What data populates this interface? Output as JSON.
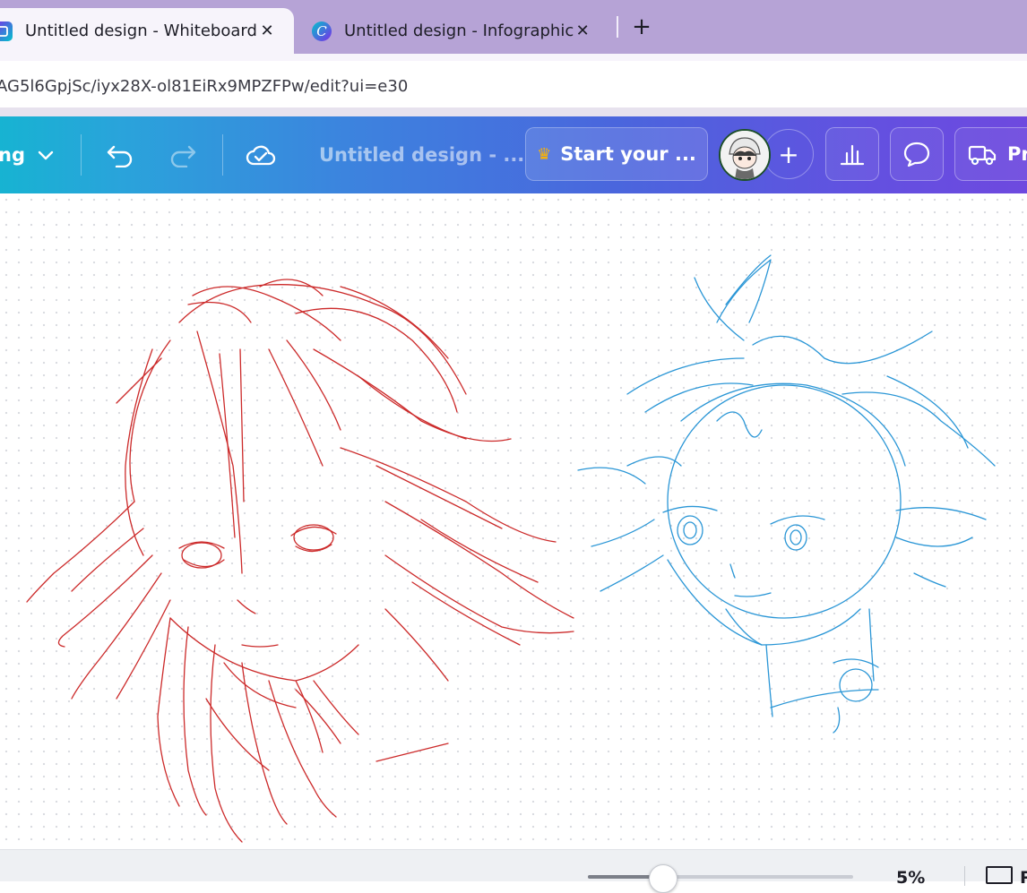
{
  "browser": {
    "tabs": [
      {
        "title": "Untitled design - Whiteboard",
        "active": true,
        "favicon": "canva-whiteboard-icon"
      },
      {
        "title": "Untitled design - Infographic",
        "active": false,
        "favicon": "canva-logo-icon"
      }
    ],
    "close_glyph": "✕",
    "new_tab_glyph": "+",
    "url": "AG5l6GpjSc/iyx28X-ol81EiRx9MPZFPw/edit?ui=e30"
  },
  "toolbar": {
    "mode_label": "ng",
    "design_title": "Untitled design - ...",
    "upgrade_label": "Start your ...",
    "print_label": "Pr",
    "plus_label": "+",
    "colors": {
      "gradient_start": "#17b3d2",
      "gradient_end": "#6e49df"
    }
  },
  "canvas": {
    "sketches": [
      {
        "name": "red-character-sketch",
        "stroke_color": "#cc2a2a"
      },
      {
        "name": "blue-character-sketch",
        "stroke_color": "#2a96d6"
      }
    ]
  },
  "footer": {
    "zoom_label": "5%",
    "zoom_level_fraction": 0.28,
    "pages_label": "P"
  }
}
